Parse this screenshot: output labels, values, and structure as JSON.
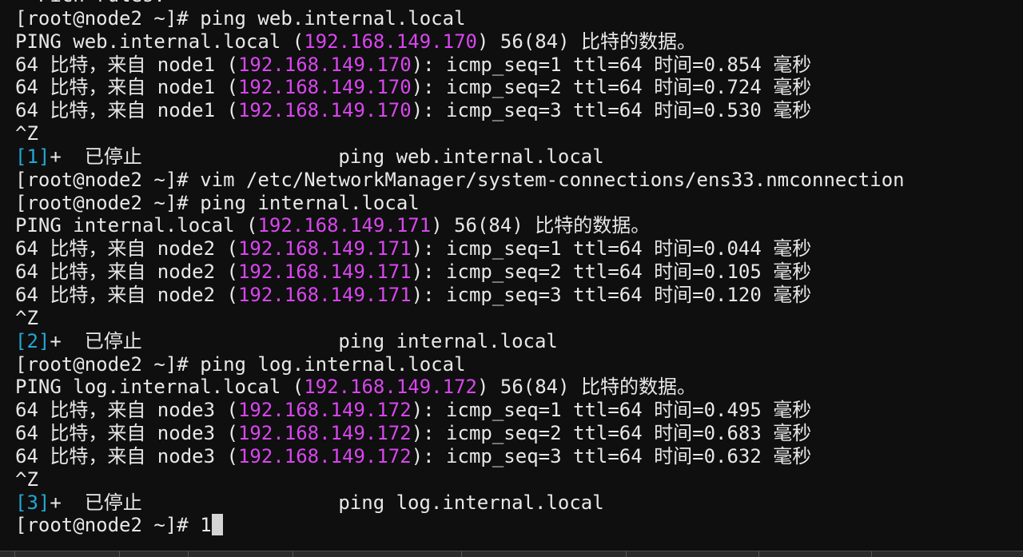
{
  "terminal": {
    "lines": [
      {
        "text": "  Pich rules."
      },
      {
        "text": "[root@node2 ~]# ping web.internal.local"
      },
      {
        "pre": "PING web.internal.local (",
        "ip": "192.168.149.170",
        "post": ") 56(84) 比特的数据。"
      },
      {
        "pre": "64 比特，来自 node1 (",
        "ip": "192.168.149.170",
        "post": "): icmp_seq=1 ttl=64 时间=0.854 毫秒"
      },
      {
        "pre": "64 比特，来自 node1 (",
        "ip": "192.168.149.170",
        "post": "): icmp_seq=2 ttl=64 时间=0.724 毫秒"
      },
      {
        "pre": "64 比特，来自 node1 (",
        "ip": "192.168.149.170",
        "post": "): icmp_seq=3 ttl=64 时间=0.530 毫秒"
      },
      {
        "text": "^Z"
      },
      {
        "job": "[1]",
        "rest": "+  已停止                 ping web.internal.local"
      },
      {
        "text": "[root@node2 ~]# vim /etc/NetworkManager/system-connections/ens33.nmconnection"
      },
      {
        "text": "[root@node2 ~]# ping internal.local"
      },
      {
        "pre": "PING internal.local (",
        "ip": "192.168.149.171",
        "post": ") 56(84) 比特的数据。"
      },
      {
        "pre": "64 比特，来自 node2 (",
        "ip": "192.168.149.171",
        "post": "): icmp_seq=1 ttl=64 时间=0.044 毫秒"
      },
      {
        "pre": "64 比特，来自 node2 (",
        "ip": "192.168.149.171",
        "post": "): icmp_seq=2 ttl=64 时间=0.105 毫秒"
      },
      {
        "pre": "64 比特，来自 node2 (",
        "ip": "192.168.149.171",
        "post": "): icmp_seq=3 ttl=64 时间=0.120 毫秒"
      },
      {
        "text": "^Z"
      },
      {
        "job": "[2]",
        "rest": "+  已停止                 ping internal.local"
      },
      {
        "text": "[root@node2 ~]# ping log.internal.local"
      },
      {
        "pre": "PING log.internal.local (",
        "ip": "192.168.149.172",
        "post": ") 56(84) 比特的数据。"
      },
      {
        "pre": "64 比特，来自 node3 (",
        "ip": "192.168.149.172",
        "post": "): icmp_seq=1 ttl=64 时间=0.495 毫秒"
      },
      {
        "pre": "64 比特，来自 node3 (",
        "ip": "192.168.149.172",
        "post": "): icmp_seq=2 ttl=64 时间=0.683 毫秒"
      },
      {
        "pre": "64 比特，来自 node3 (",
        "ip": "192.168.149.172",
        "post": "): icmp_seq=3 ttl=64 时间=0.632 毫秒"
      },
      {
        "text": "^Z"
      },
      {
        "job": "[3]",
        "rest": "+  已停止                 ping log.internal.local"
      }
    ],
    "prompt": {
      "text": "[root@node2 ~]# ",
      "input": "1"
    }
  },
  "colors": {
    "background": "#0f0f0f",
    "foreground": "#e8e8e8",
    "ip": "#d946ef",
    "job": "#22a8d6"
  }
}
